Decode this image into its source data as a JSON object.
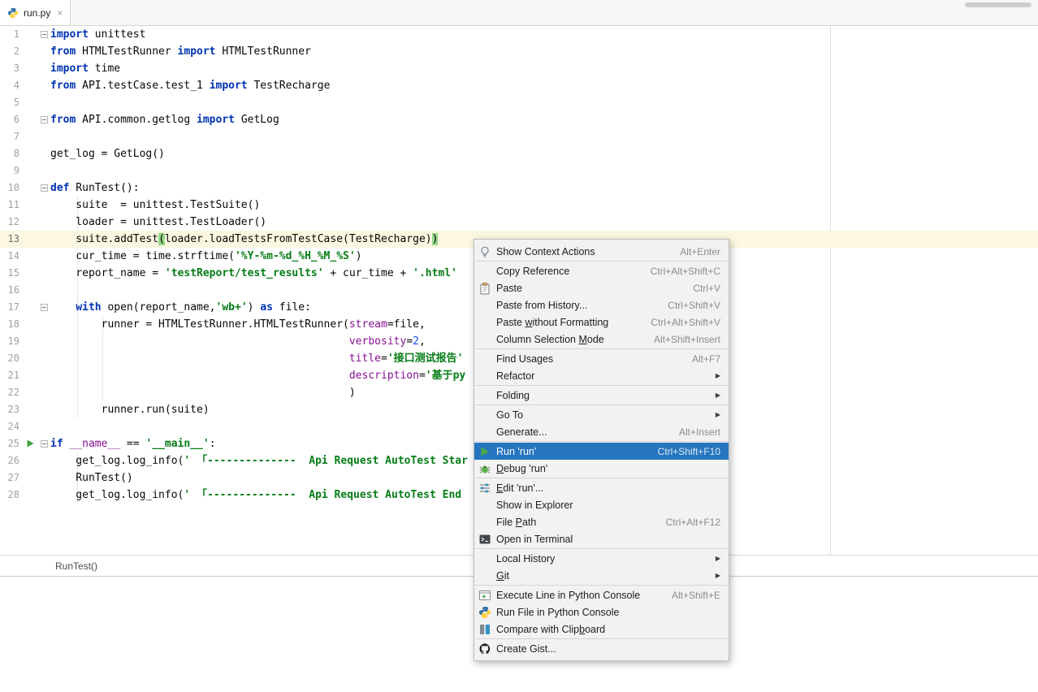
{
  "tab": {
    "title": "run.py",
    "close_glyph": "×"
  },
  "breadcrumb": {
    "text": "RunTest()"
  },
  "colors": {
    "selection-bg": "#2675BF",
    "keyword": "#0033B3",
    "string": "#067D17",
    "number": "#1750EB",
    "named-arg": "#871094",
    "plain": "#080808",
    "caret-row": "#FBF7E0",
    "brace-match": "#93D987",
    "line-number": "#A1A1A1",
    "menu-bg": "#F2F2F2",
    "run-green": "#4DA652"
  },
  "editor": {
    "current_line": 13,
    "lines": [
      {
        "n": 1,
        "fold": true,
        "tokens": [
          {
            "c": "kw",
            "t": "import"
          },
          {
            "c": "pln",
            "t": " unittest"
          }
        ]
      },
      {
        "n": 2,
        "tokens": [
          {
            "c": "kw",
            "t": "from"
          },
          {
            "c": "pln",
            "t": " HTMLTestRunner "
          },
          {
            "c": "kw",
            "t": "import"
          },
          {
            "c": "pln",
            "t": " HTMLTestRunner"
          }
        ]
      },
      {
        "n": 3,
        "tokens": [
          {
            "c": "kw",
            "t": "import"
          },
          {
            "c": "pln",
            "t": " time"
          }
        ]
      },
      {
        "n": 4,
        "tokens": [
          {
            "c": "kw",
            "t": "from"
          },
          {
            "c": "pln",
            "t": " API.testCase.test_1 "
          },
          {
            "c": "kw",
            "t": "import"
          },
          {
            "c": "pln",
            "t": " TestRecharge"
          }
        ]
      },
      {
        "n": 5,
        "tokens": []
      },
      {
        "n": 6,
        "fold": true,
        "tokens": [
          {
            "c": "kw",
            "t": "from"
          },
          {
            "c": "pln",
            "t": " API.common.getlog "
          },
          {
            "c": "kw",
            "t": "import"
          },
          {
            "c": "pln",
            "t": " GetLog"
          }
        ]
      },
      {
        "n": 7,
        "tokens": []
      },
      {
        "n": 8,
        "tokens": [
          {
            "c": "pln",
            "t": "get_log = GetLog()"
          }
        ]
      },
      {
        "n": 9,
        "tokens": []
      },
      {
        "n": 10,
        "fold": true,
        "tokens": [
          {
            "c": "kw",
            "t": "def"
          },
          {
            "c": "pln",
            "t": " RunTest():"
          }
        ]
      },
      {
        "n": 11,
        "tokens": [
          {
            "c": "pln",
            "t": "    suite  = unittest.TestSuite()"
          }
        ]
      },
      {
        "n": 12,
        "tokens": [
          {
            "c": "pln",
            "t": "    loader = unittest.TestLoader()"
          }
        ]
      },
      {
        "n": 13,
        "tokens": [
          {
            "c": "pln",
            "t": "    suite.addTest"
          },
          {
            "c": "brc",
            "t": "("
          },
          {
            "c": "pln",
            "t": "loader.loadTestsFromTestCase(TestRecharge)"
          },
          {
            "c": "brc",
            "t": ")"
          }
        ]
      },
      {
        "n": 14,
        "tokens": [
          {
            "c": "pln",
            "t": "    cur_time = time.strftime("
          },
          {
            "c": "str",
            "t": "'%Y-%m-%d_%H_%M_%S'"
          },
          {
            "c": "pln",
            "t": ")"
          }
        ]
      },
      {
        "n": 15,
        "tokens": [
          {
            "c": "pln",
            "t": "    report_name = "
          },
          {
            "c": "str",
            "t": "'testReport/test_results'"
          },
          {
            "c": "pln",
            "t": " + cur_time + "
          },
          {
            "c": "str",
            "t": "'.html'"
          }
        ]
      },
      {
        "n": 16,
        "tokens": []
      },
      {
        "n": 17,
        "fold": true,
        "tokens": [
          {
            "c": "pln",
            "t": "    "
          },
          {
            "c": "kw",
            "t": "with"
          },
          {
            "c": "pln",
            "t": " open(report_name,"
          },
          {
            "c": "str",
            "t": "'wb+'"
          },
          {
            "c": "pln",
            "t": ") "
          },
          {
            "c": "kw",
            "t": "as"
          },
          {
            "c": "pln",
            "t": " file:"
          }
        ]
      },
      {
        "n": 18,
        "tokens": [
          {
            "c": "pln",
            "t": "        runner = HTMLTestRunner.HTMLTestRunner("
          },
          {
            "c": "prm",
            "t": "stream"
          },
          {
            "c": "pln",
            "t": "=file,"
          }
        ]
      },
      {
        "n": 19,
        "tokens": [
          {
            "c": "pln",
            "t": "                                               "
          },
          {
            "c": "prm",
            "t": "verbosity"
          },
          {
            "c": "pln",
            "t": "="
          },
          {
            "c": "num",
            "t": "2"
          },
          {
            "c": "pln",
            "t": ","
          }
        ]
      },
      {
        "n": 20,
        "tokens": [
          {
            "c": "pln",
            "t": "                                               "
          },
          {
            "c": "prm",
            "t": "title"
          },
          {
            "c": "pln",
            "t": "="
          },
          {
            "c": "str",
            "t": "'接口测试报告'"
          }
        ]
      },
      {
        "n": 21,
        "tokens": [
          {
            "c": "pln",
            "t": "                                               "
          },
          {
            "c": "prm",
            "t": "description"
          },
          {
            "c": "pln",
            "t": "="
          },
          {
            "c": "str",
            "t": "'基于py"
          }
        ]
      },
      {
        "n": 22,
        "tokens": [
          {
            "c": "pln",
            "t": "                                               )"
          }
        ]
      },
      {
        "n": 23,
        "tokens": [
          {
            "c": "pln",
            "t": "        runner.run(suite)"
          }
        ]
      },
      {
        "n": 24,
        "tokens": []
      },
      {
        "n": 25,
        "fold": true,
        "run": true,
        "tokens": [
          {
            "c": "kw",
            "t": "if"
          },
          {
            "c": "pln",
            "t": " "
          },
          {
            "c": "prm",
            "t": "__name__"
          },
          {
            "c": "pln",
            "t": " == "
          },
          {
            "c": "str",
            "t": "'__main__'"
          },
          {
            "c": "pln",
            "t": ":"
          }
        ]
      },
      {
        "n": 26,
        "tokens": [
          {
            "c": "pln",
            "t": "    get_log.log_info("
          },
          {
            "c": "str",
            "t": "' 「--------------  Api Request AutoTest Star"
          }
        ]
      },
      {
        "n": 27,
        "tokens": [
          {
            "c": "pln",
            "t": "    RunTest()"
          }
        ]
      },
      {
        "n": 28,
        "tokens": [
          {
            "c": "pln",
            "t": "    get_log.log_info("
          },
          {
            "c": "str",
            "t": "' 「--------------  Api Request AutoTest End "
          }
        ]
      }
    ]
  },
  "context_menu": {
    "items": [
      {
        "icon": "context-actions-icon",
        "label": "Show Context Actions",
        "shortcut": "Alt+Enter"
      },
      {
        "type": "separator"
      },
      {
        "label": "Copy Reference",
        "shortcut": "Ctrl+Alt+Shift+C"
      },
      {
        "icon": "paste-icon",
        "label": "Paste",
        "shortcut": "Ctrl+V"
      },
      {
        "label": "Paste from History...",
        "shortcut": "Ctrl+Shift+V"
      },
      {
        "label": "Paste &without Formatting",
        "shortcut": "Ctrl+Alt+Shift+V"
      },
      {
        "label": "Column Selection &Mode",
        "shortcut": "Alt+Shift+Insert"
      },
      {
        "type": "separator"
      },
      {
        "label": "Find Usages",
        "shortcut": "Alt+F7"
      },
      {
        "label": "Refactor",
        "submenu": true
      },
      {
        "type": "separator"
      },
      {
        "label": "Folding",
        "submenu": true
      },
      {
        "type": "separator"
      },
      {
        "label": "Go To",
        "submenu": true
      },
      {
        "label": "Generate...",
        "shortcut": "Alt+Insert"
      },
      {
        "type": "separator"
      },
      {
        "icon": "run-icon",
        "label": "Run 'run'",
        "shortcut": "Ctrl+Shift+F10",
        "selected": true
      },
      {
        "icon": "debug-icon",
        "label": "&Debug 'run'"
      },
      {
        "type": "separator"
      },
      {
        "icon": "edit-run-icon",
        "label": "&Edit 'run'..."
      },
      {
        "label": "Show in Explorer"
      },
      {
        "label": "File &Path",
        "shortcut": "Ctrl+Alt+F12"
      },
      {
        "icon": "terminal-icon",
        "label": "Open in Terminal"
      },
      {
        "type": "separator"
      },
      {
        "label": "Local History",
        "submenu": true
      },
      {
        "label": "&Git",
        "submenu": true
      },
      {
        "type": "separator"
      },
      {
        "icon": "execute-console-icon",
        "label": "Execute Line in Python Console",
        "shortcut": "Alt+Shift+E"
      },
      {
        "icon": "python-console-icon",
        "label": "Run File in Python Console"
      },
      {
        "icon": "compare-clipboard-icon",
        "label": "Compare with Clip&board"
      },
      {
        "type": "separator"
      },
      {
        "icon": "gist-icon",
        "label": "Create Gist..."
      }
    ]
  }
}
